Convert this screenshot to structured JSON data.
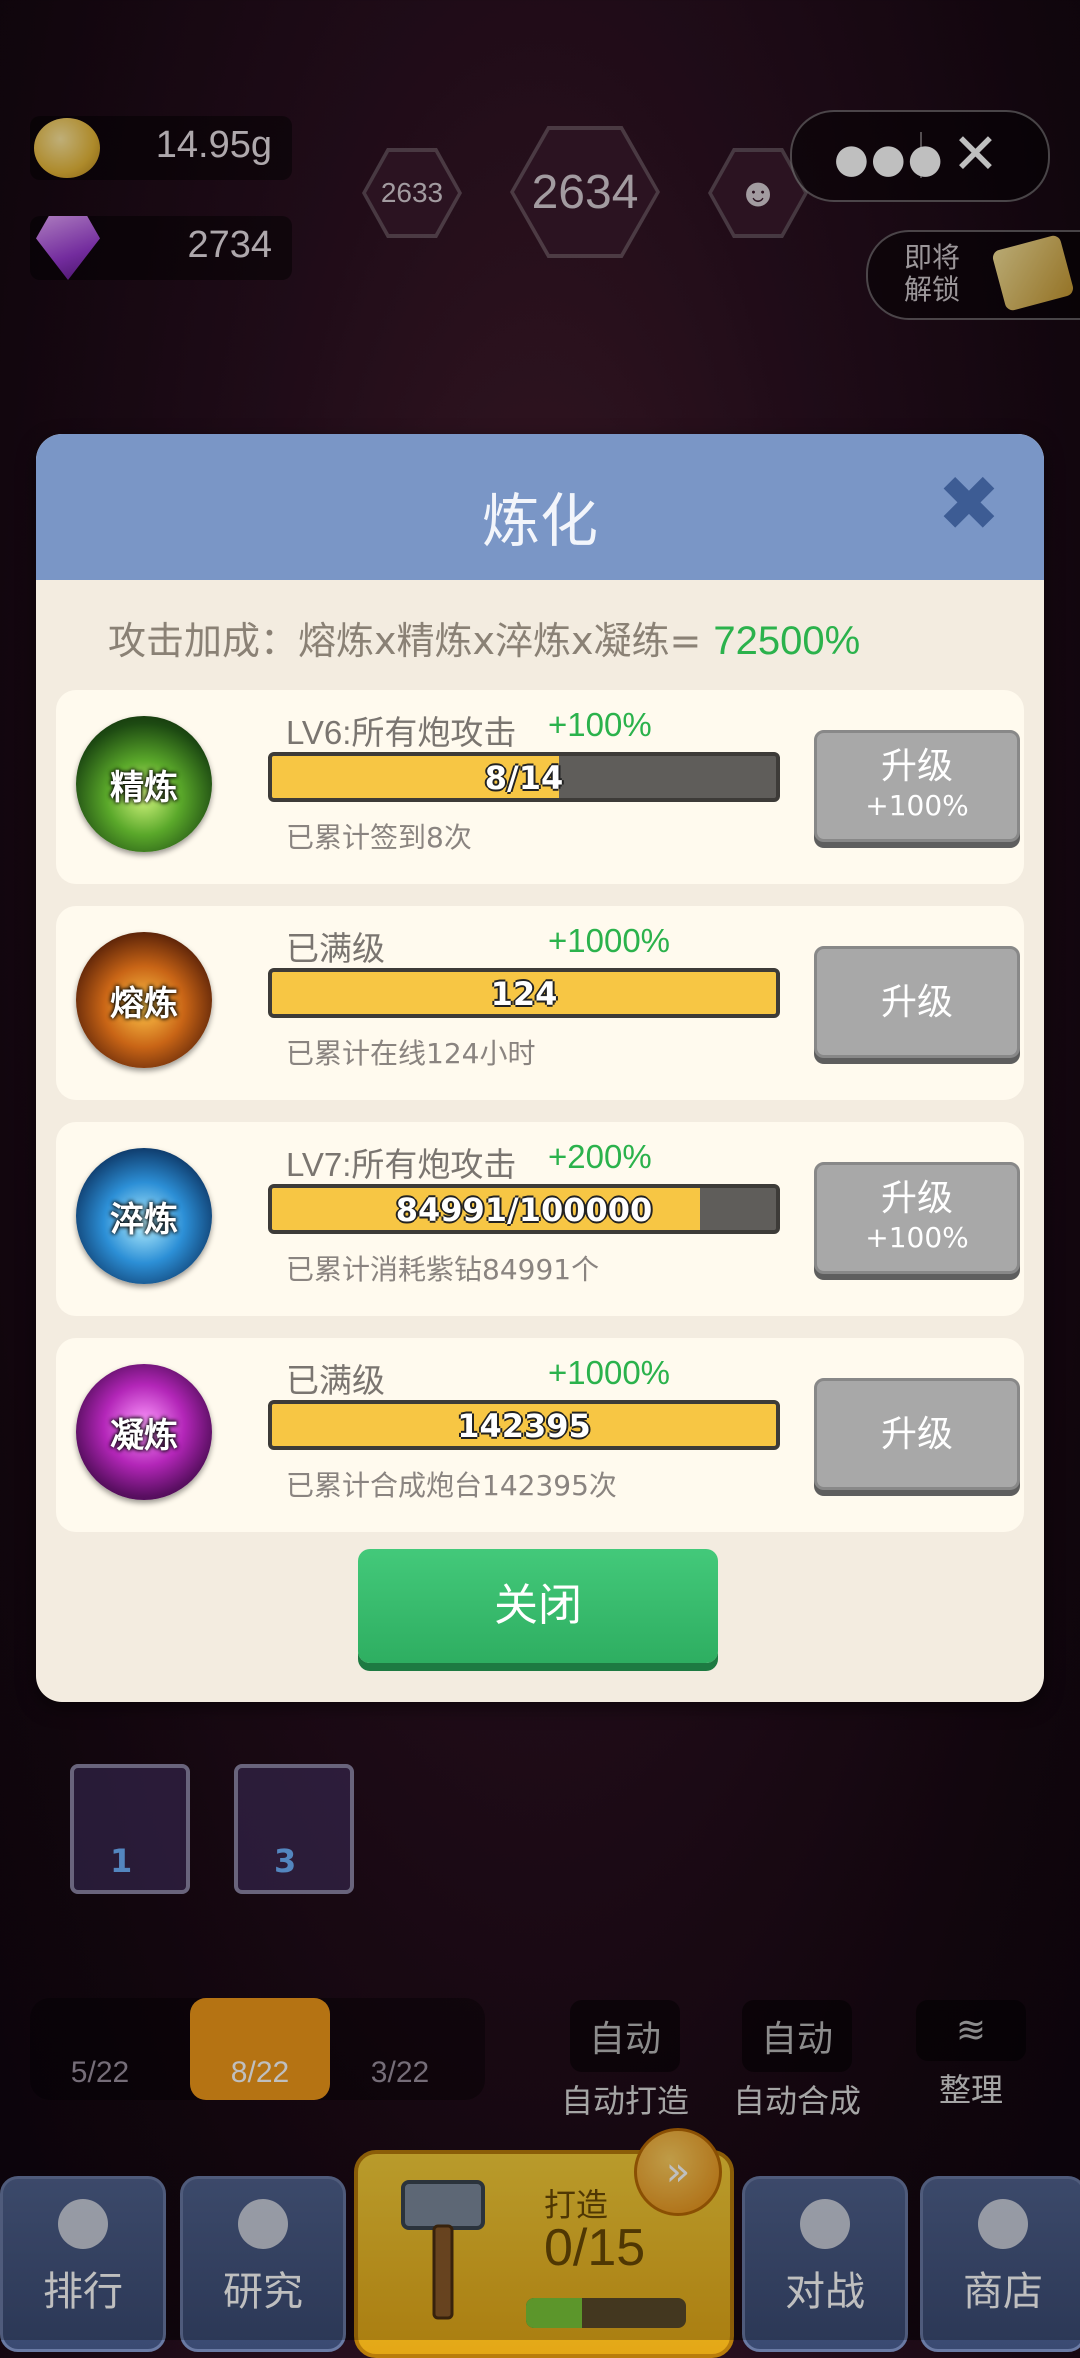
{
  "hud": {
    "gold": "14.95g",
    "gems": "2734",
    "level_prev": "2633",
    "level_current": "2634",
    "unlock_label": "即将\n解锁"
  },
  "modal": {
    "title": "炼化",
    "bonus_label": "攻击加成：熔炼x精炼x淬炼x凝练=",
    "bonus_value": "72500%",
    "cards": [
      {
        "orb_label": "精炼",
        "title": "LV6:所有炮攻击",
        "bonus": "+100%",
        "progress_text": "8/14",
        "progress": 0.57,
        "note": "已累计签到8次",
        "button_label": "升级",
        "button_sub": "+100%"
      },
      {
        "orb_label": "熔炼",
        "title": "已满级",
        "bonus": "+1000%",
        "progress_text": "124",
        "progress": 1.0,
        "note": "已累计在线124小时",
        "button_label": "升级",
        "button_sub": ""
      },
      {
        "orb_label": "淬炼",
        "title": "LV7:所有炮攻击",
        "bonus": "+200%",
        "progress_text": "84991/100000",
        "progress": 0.85,
        "note": "已累计消耗紫钻84991个",
        "button_label": "升级",
        "button_sub": "+100%"
      },
      {
        "orb_label": "凝炼",
        "title": "已满级",
        "bonus": "+1000%",
        "progress_text": "142395",
        "progress": 1.0,
        "note": "已累计合成炮台142395次",
        "button_label": "升级",
        "button_sub": ""
      }
    ],
    "close_label": "关闭"
  },
  "game": {
    "slot_badges": [
      "1",
      "3"
    ],
    "dock": [
      "5/22",
      "8/22",
      "3/22"
    ],
    "auto_buttons": [
      {
        "top": "自动",
        "sub": "自动打造"
      },
      {
        "top": "自动",
        "sub": "自动合成"
      }
    ],
    "tidy_label": "整理",
    "nav": [
      "排行",
      "研究",
      "对战",
      "商店"
    ],
    "forge_label": "打造",
    "forge_count": "0/15",
    "forge_progress": 0.35
  }
}
